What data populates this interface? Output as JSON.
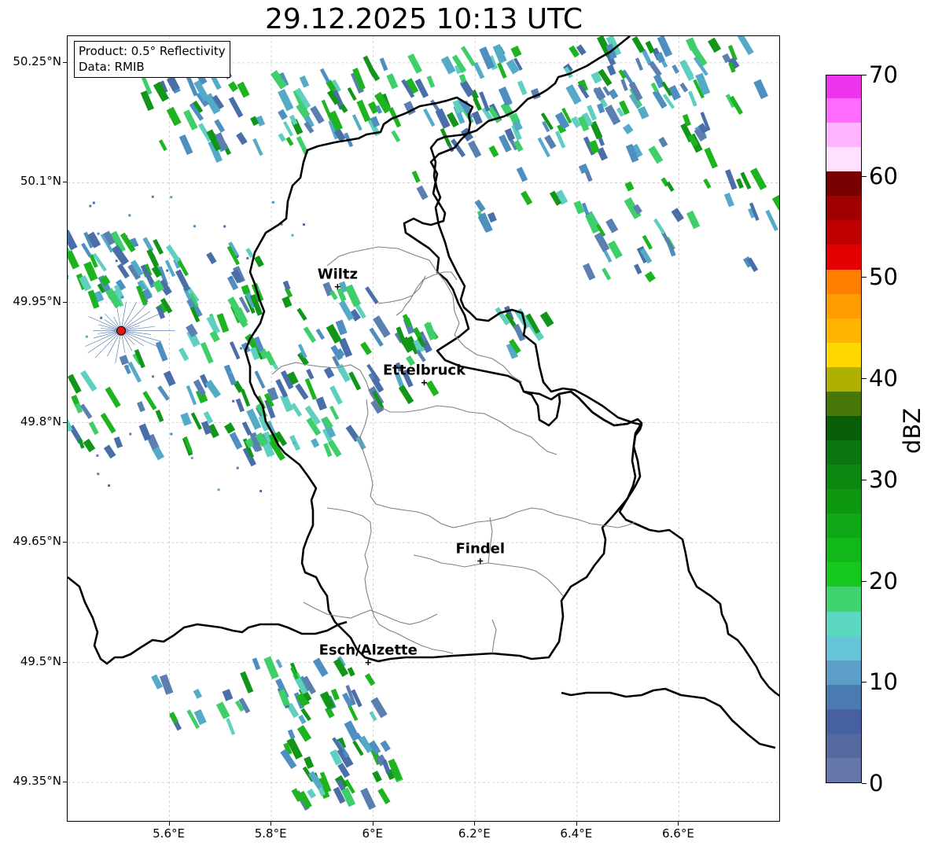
{
  "title": "29.12.2025 10:13 UTC",
  "info": {
    "product": "Product: 0.5° Reflectivity",
    "source": "Data: RMIB"
  },
  "lat_labels": [
    "50.25°N",
    "50.1°N",
    "49.95°N",
    "49.8°N",
    "49.65°N",
    "49.5°N",
    "49.35°N"
  ],
  "lon_labels": [
    "5.6°E",
    "5.8°E",
    "6°E",
    "6.2°E",
    "6.4°E",
    "6.6°E"
  ],
  "cities": [
    {
      "name": "Wiltz",
      "lon": 5.93,
      "lat": 49.97
    },
    {
      "name": "Ettelbruck",
      "lon": 6.1,
      "lat": 49.85
    },
    {
      "name": "Findel",
      "lon": 6.21,
      "lat": 49.627
    },
    {
      "name": "Esch/Alzette",
      "lon": 5.99,
      "lat": 49.5
    }
  ],
  "radar_site": {
    "lon": 5.505,
    "lat": 49.915
  },
  "colorbar": {
    "label": "dBZ",
    "min": 0,
    "max": 70,
    "ticks": [
      "0",
      "10",
      "20",
      "30",
      "40",
      "50",
      "60",
      "70"
    ],
    "colors": [
      "#6477a8",
      "#55699e",
      "#4660a0",
      "#4a7ab0",
      "#5c9ec8",
      "#66c4d8",
      "#5cd8c0",
      "#40d470",
      "#14c81e",
      "#12b81a",
      "#10a816",
      "#0e9812",
      "#0c8810",
      "#0a780e",
      "#085e08",
      "#487808",
      "#b0b000",
      "#ffd800",
      "#ffb400",
      "#ff9c00",
      "#ff8000",
      "#e40000",
      "#c00000",
      "#a00000",
      "#780000",
      "#ffe0ff",
      "#ffb4ff",
      "#ff6cff",
      "#ee34ee"
    ]
  }
}
